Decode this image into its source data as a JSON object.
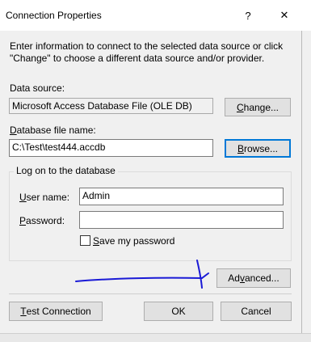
{
  "window": {
    "title": "Connection Properties",
    "help_glyph": "?",
    "close_glyph": "✕"
  },
  "intro_text": "Enter information to connect to the selected data source or click \"Change\" to choose a different data source and/or provider.",
  "data_source": {
    "label": "Data source:",
    "value": "Microsoft Access Database File (OLE DB)",
    "change_button": {
      "before": "",
      "accel": "C",
      "after": "hange..."
    }
  },
  "database_file": {
    "label": {
      "before": "",
      "accel": "D",
      "after": "atabase file name:"
    },
    "value": "C:\\Test\\test444.accdb",
    "browse_button": {
      "before": "",
      "accel": "B",
      "after": "rowse..."
    }
  },
  "logon": {
    "group_title": "Log on to the database",
    "user_name": {
      "label": {
        "before": "",
        "accel": "U",
        "after": "ser name:"
      },
      "value": "Admin"
    },
    "password": {
      "label": {
        "before": "",
        "accel": "P",
        "after": "assword:"
      },
      "value": ""
    },
    "save_password": {
      "label": {
        "before": "",
        "accel": "S",
        "after": "ave my password"
      },
      "checked": false
    }
  },
  "buttons": {
    "advanced": {
      "before": "Ad",
      "accel": "v",
      "after": "anced..."
    },
    "test_connection": {
      "before": "",
      "accel": "T",
      "after": "est Connection"
    },
    "ok": "OK",
    "cancel": "Cancel"
  },
  "annotation": {
    "stroke_color": "#1a1ad6"
  }
}
